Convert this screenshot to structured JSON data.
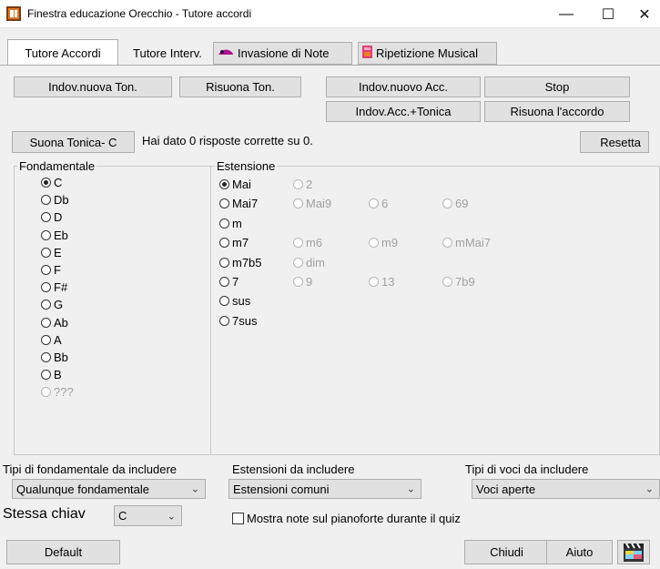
{
  "window": {
    "title": "Finestra educazione Orecchio - Tutore accordi",
    "minimize": "—",
    "maximize": "☐",
    "close": "✕"
  },
  "tabs": {
    "chord_tutor": "Tutore Accordi",
    "interval_tutor": "Tutore Interv.",
    "note_invasion": "Invasione di Note",
    "musical_repeat": "Ripetizione Musical"
  },
  "buttons": {
    "guess_new_key": "Indov.nuova Ton.",
    "replay_key": "Risuona Ton.",
    "guess_new_chord": "Indov.nuovo Acc.",
    "stop": "Stop",
    "guess_chord_key": "Indov.Acc.+Tonica",
    "replay_chord": "Risuona l'accordo",
    "play_key": "Suona Tonica- C",
    "reset": "Resetta",
    "default": "Default",
    "close": "Chiudi",
    "help": "Aiuto"
  },
  "score_text": "Hai dato 0 risposte corrette su 0.",
  "root": {
    "label": "Fondamentale",
    "options": [
      "C",
      "Db",
      "D",
      "Eb",
      "E",
      "F",
      "F#",
      "G",
      "Ab",
      "A",
      "Bb",
      "B",
      "???"
    ],
    "selected": "C"
  },
  "extension": {
    "label": "Estensione",
    "selected": "Mai",
    "rows": [
      [
        "Mai",
        "2"
      ],
      [
        "Mai7",
        "Mai9",
        "6",
        "69"
      ],
      [
        "m"
      ],
      [
        "m7",
        "m6",
        "m9",
        "mMai7"
      ],
      [
        "m7b5",
        "dim"
      ],
      [
        "7",
        "9",
        "13",
        "7b9"
      ],
      [
        "sus"
      ],
      [
        "7sus"
      ]
    ]
  },
  "filters": {
    "root_types_label": "Tipi di fondamentale da includere",
    "root_types_value": "Qualunque fondamentale",
    "extensions_label": "Estensioni da includere",
    "extensions_value": "Estensioni comuni",
    "voicing_label": "Tipi di voci da includere",
    "voicing_value": "Voci aperte",
    "same_key_label": "Stessa chiav",
    "same_key_value": "C",
    "show_piano_label": "Mostra note sul pianoforte durante il quiz",
    "show_piano_checked": false
  }
}
